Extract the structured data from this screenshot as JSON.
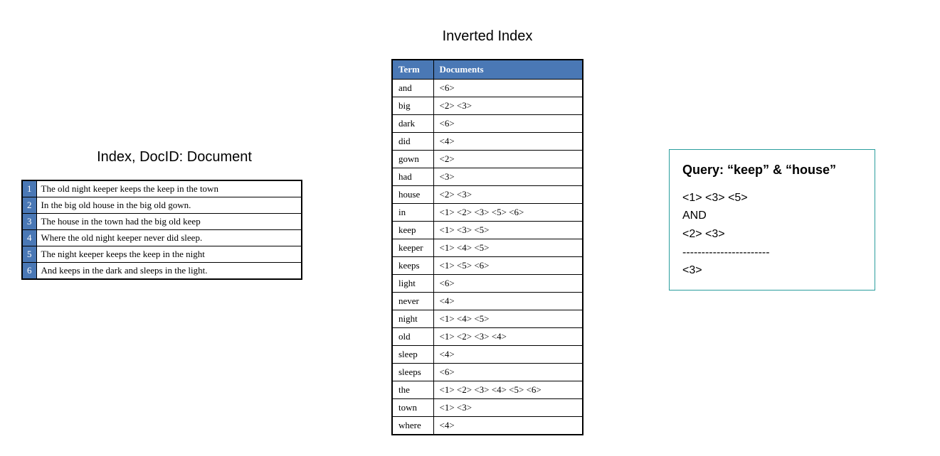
{
  "left": {
    "title": "Index, DocID: Document",
    "rows": [
      {
        "id": "1",
        "text": "The old night keeper keeps the keep in the town"
      },
      {
        "id": "2",
        "text": "In the big old house in the big old gown."
      },
      {
        "id": "3",
        "text": "The house in the town had the big old keep"
      },
      {
        "id": "4",
        "text": "Where the old night keeper never did sleep."
      },
      {
        "id": "5",
        "text": "The night keeper keeps the keep in the night"
      },
      {
        "id": "6",
        "text": "And keeps in the dark and sleeps in the light."
      }
    ]
  },
  "mid": {
    "title": "Inverted Index",
    "header_term": "Term",
    "header_docs": "Documents",
    "rows": [
      {
        "term": "and",
        "docs": "<6>"
      },
      {
        "term": "big",
        "docs": "<2> <3>"
      },
      {
        "term": "dark",
        "docs": "<6>"
      },
      {
        "term": "did",
        "docs": "<4>"
      },
      {
        "term": "gown",
        "docs": "<2>"
      },
      {
        "term": "had",
        "docs": "<3>"
      },
      {
        "term": "house",
        "docs": "<2> <3>"
      },
      {
        "term": "in",
        "docs": "<1> <2> <3> <5> <6>"
      },
      {
        "term": "keep",
        "docs": "<1> <3> <5>"
      },
      {
        "term": "keeper",
        "docs": "<1> <4> <5>"
      },
      {
        "term": "keeps",
        "docs": "<1> <5> <6>"
      },
      {
        "term": "light",
        "docs": "<6>"
      },
      {
        "term": "never",
        "docs": "<4>"
      },
      {
        "term": "night",
        "docs": "<1> <4> <5>"
      },
      {
        "term": "old",
        "docs": "<1> <2> <3> <4>"
      },
      {
        "term": "sleep",
        "docs": "<4>"
      },
      {
        "term": "sleeps",
        "docs": "<6>"
      },
      {
        "term": "the",
        "docs": "<1> <2> <3> <4> <5> <6>"
      },
      {
        "term": "town",
        "docs": "<1> <3>"
      },
      {
        "term": "where",
        "docs": "<4>"
      }
    ]
  },
  "right": {
    "title": "Query: “keep” & “house”",
    "line1": "<1> <3> <5>",
    "op": "AND",
    "line2": "<2> <3>",
    "sep": "-----------------------",
    "result": "<3>"
  }
}
